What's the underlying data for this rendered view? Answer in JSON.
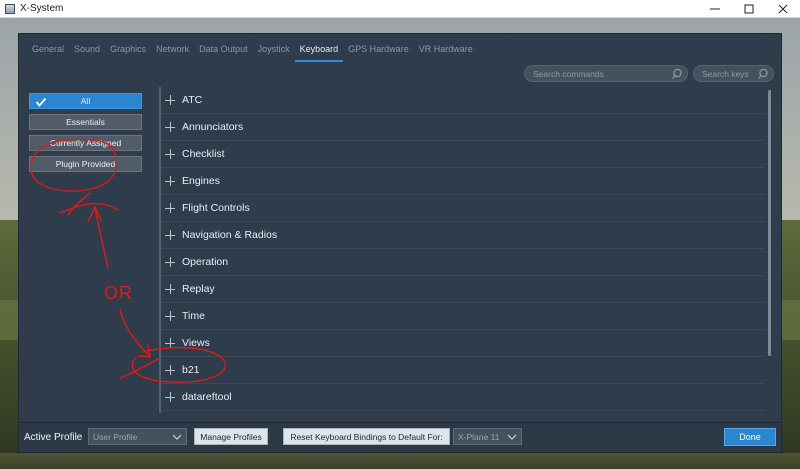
{
  "window": {
    "title": "X-System"
  },
  "tabs": [
    {
      "label": "General"
    },
    {
      "label": "Sound"
    },
    {
      "label": "Graphics"
    },
    {
      "label": "Network"
    },
    {
      "label": "Data Output"
    },
    {
      "label": "Joystick"
    },
    {
      "label": "Keyboard",
      "active": true
    },
    {
      "label": "GPS Hardware"
    },
    {
      "label": "VR Hardware"
    }
  ],
  "search": {
    "commands_placeholder": "Search commands",
    "keys_placeholder": "Search keys"
  },
  "filters": [
    {
      "label": "All",
      "active": true
    },
    {
      "label": "Essentials"
    },
    {
      "label": "Currently Assigned"
    },
    {
      "label": "Plugin Provided"
    }
  ],
  "categories": [
    {
      "label": "ATC"
    },
    {
      "label": "Annunciators"
    },
    {
      "label": "Checklist"
    },
    {
      "label": "Engines"
    },
    {
      "label": "Flight Controls"
    },
    {
      "label": "Navigation & Radios"
    },
    {
      "label": "Operation"
    },
    {
      "label": "Replay"
    },
    {
      "label": "Time"
    },
    {
      "label": "Views"
    },
    {
      "label": "b21"
    },
    {
      "label": "datareftool"
    }
  ],
  "footer": {
    "active_profile_label": "Active Profile",
    "profile_value": "User Profile",
    "manage_profiles_label": "Manage Profiles",
    "reset_label": "Reset Keyboard Bindings to Default For:",
    "reset_target_value": "X-Plane 11",
    "done_label": "Done"
  },
  "annotation": {
    "or_text": "OR",
    "color": "#e01a1a"
  },
  "colors": {
    "accent": "#2b86d1",
    "panel": "#2e3c4c"
  }
}
